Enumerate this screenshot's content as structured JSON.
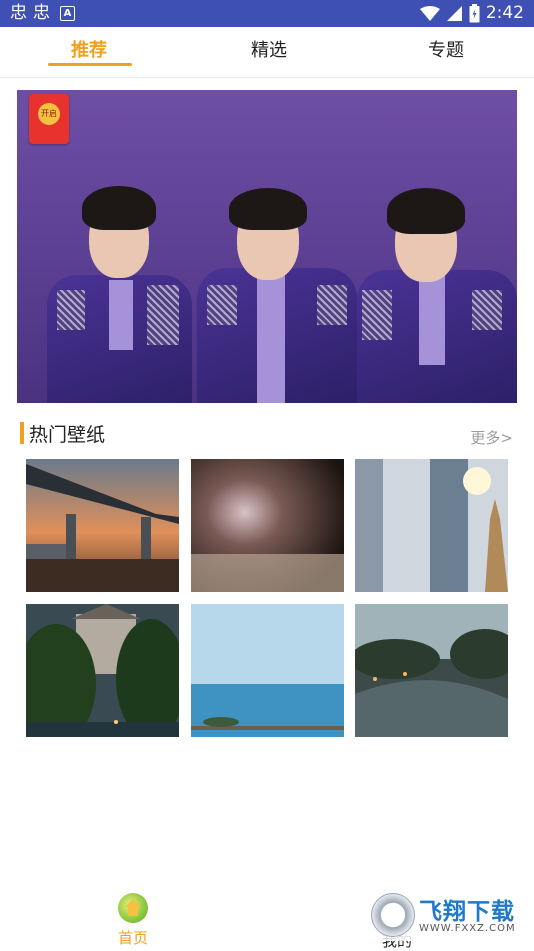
{
  "status_bar": {
    "left_glyphs": [
      "忠",
      "忠"
    ],
    "notification_badge": "A",
    "time": "2:42",
    "icons": [
      "wifi-icon",
      "signal-icon",
      "battery-icon"
    ]
  },
  "tabs": [
    {
      "label": "推荐",
      "active": true
    },
    {
      "label": "精选",
      "active": false
    },
    {
      "label": "专题",
      "active": false
    }
  ],
  "banner": {
    "red_packet_label": "开启"
  },
  "section": {
    "title": "热门壁纸",
    "more_label": "更多>"
  },
  "wallpapers": [
    {
      "subject": "bridge at sunset"
    },
    {
      "subject": "blurred close-up"
    },
    {
      "subject": "city skyscrapers"
    },
    {
      "subject": "castle and trees at dusk"
    },
    {
      "subject": "sea horizon"
    },
    {
      "subject": "water town canal at dusk"
    }
  ],
  "bottom_nav": {
    "home_label": "首页",
    "me_label": "我的"
  },
  "watermark": {
    "title": "飞翔下载",
    "url": "WWW.FXXZ.COM"
  },
  "colors": {
    "accent": "#f0a020",
    "status_bar": "#3f50b5"
  }
}
